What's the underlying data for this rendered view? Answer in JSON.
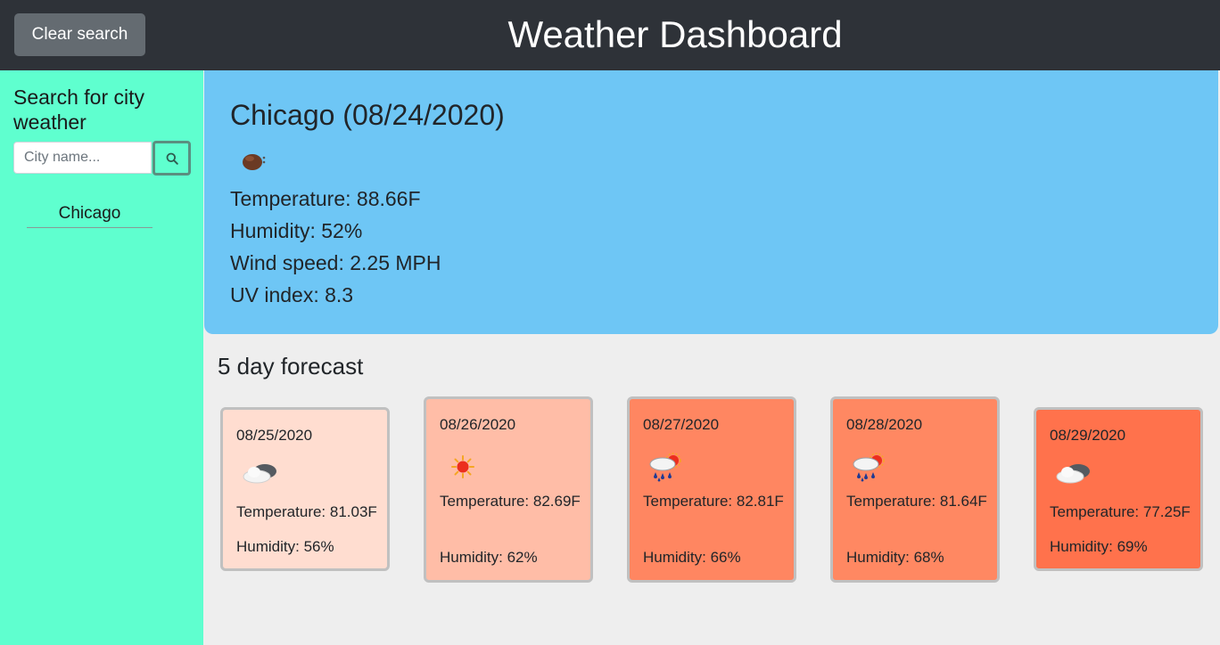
{
  "header": {
    "clear_label": "Clear search",
    "title": "Weather Dashboard"
  },
  "sidebar": {
    "title": "Search for city weather",
    "search_placeholder": "City name...",
    "search_value": "",
    "history": [
      "Chicago"
    ]
  },
  "current": {
    "title": "Chicago (08/24/2020)",
    "icon": "haze-icon",
    "temperature": "Temperature: 88.66F",
    "humidity": "Humidity: 52%",
    "wind": "Wind speed: 2.25 MPH",
    "uv": "UV index: 8.3"
  },
  "forecast": {
    "title": "5 day forecast",
    "days": [
      {
        "date": "08/25/2020",
        "icon": "cloudy-icon",
        "temp": "Temperature: 81.03F",
        "humidity": "Humidity: 56%",
        "color": "#ffddd0"
      },
      {
        "date": "08/26/2020",
        "icon": "sun-icon",
        "temp": "Temperature: 82.69F",
        "humidity": "Humidity: 62%",
        "color": "#ffbda7"
      },
      {
        "date": "08/27/2020",
        "icon": "rain-sun-icon",
        "temp": "Temperature: 82.81F",
        "humidity": "Humidity: 66%",
        "color": "#ff8661"
      },
      {
        "date": "08/28/2020",
        "icon": "rain-sun-icon",
        "temp": "Temperature: 81.64F",
        "humidity": "Humidity: 68%",
        "color": "#ff8862"
      },
      {
        "date": "08/29/2020",
        "icon": "cloudy-icon",
        "temp": "Temperature: 77.25F",
        "humidity": "Humidity: 69%",
        "color": "#ff724c"
      }
    ]
  },
  "colors": {
    "header_bg": "#2e3238",
    "sidebar_bg": "#5fffcf",
    "current_bg": "#6ec6f5",
    "page_bg": "#eeeeee"
  }
}
